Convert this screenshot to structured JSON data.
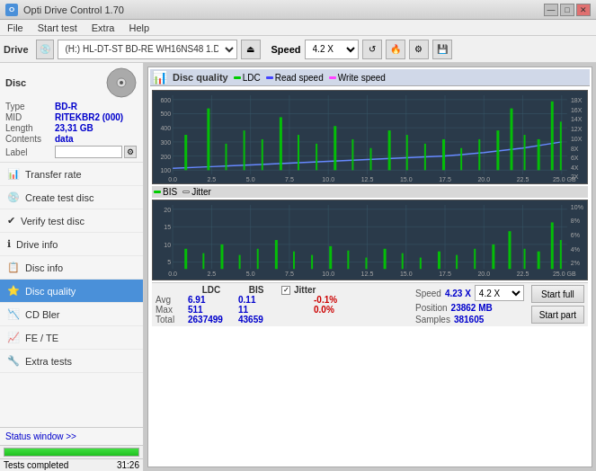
{
  "app": {
    "title": "Opti Drive Control 1.70",
    "icon_label": "ODC"
  },
  "title_controls": {
    "minimize": "—",
    "maximize": "□",
    "close": "✕"
  },
  "menu": {
    "items": [
      "File",
      "Start test",
      "Extra",
      "Help"
    ]
  },
  "toolbar": {
    "drive_label": "Drive",
    "drive_value": "(H:)  HL-DT-ST BD-RE  WH16NS48 1.D3",
    "speed_label": "Speed",
    "speed_value": "4.2 X"
  },
  "disc": {
    "section_title": "Disc",
    "type_label": "Type",
    "type_value": "BD-R",
    "mid_label": "MID",
    "mid_value": "RITEKBR2 (000)",
    "length_label": "Length",
    "length_value": "23,31 GB",
    "contents_label": "Contents",
    "contents_value": "data",
    "label_label": "Label",
    "label_placeholder": ""
  },
  "nav": {
    "items": [
      {
        "id": "transfer-rate",
        "label": "Transfer rate",
        "icon": "📊"
      },
      {
        "id": "create-test-disc",
        "label": "Create test disc",
        "icon": "💿"
      },
      {
        "id": "verify-test-disc",
        "label": "Verify test disc",
        "icon": "✔"
      },
      {
        "id": "drive-info",
        "label": "Drive info",
        "icon": "ℹ"
      },
      {
        "id": "disc-info",
        "label": "Disc info",
        "icon": "📋"
      },
      {
        "id": "disc-quality",
        "label": "Disc quality",
        "icon": "⭐",
        "active": true
      },
      {
        "id": "cd-bler",
        "label": "CD Bler",
        "icon": "📉"
      },
      {
        "id": "fe-te",
        "label": "FE / TE",
        "icon": "📈"
      },
      {
        "id": "extra-tests",
        "label": "Extra tests",
        "icon": "🔧"
      }
    ],
    "status_window": "Status window >>"
  },
  "chart_panel": {
    "title": "Disc quality",
    "legend": [
      {
        "id": "ldc",
        "label": "LDC",
        "color": "#00cc00"
      },
      {
        "id": "read-speed",
        "label": "Read speed",
        "color": "#4444ff"
      },
      {
        "id": "write-speed",
        "label": "Write speed",
        "color": "#ff44ff"
      }
    ],
    "legend2": [
      {
        "id": "bis",
        "label": "BIS",
        "color": "#00cc00"
      },
      {
        "id": "jitter",
        "label": "Jitter",
        "color": "#ffffff"
      }
    ],
    "upper_chart": {
      "y_left": [
        "600",
        "500",
        "400",
        "300",
        "200",
        "100"
      ],
      "y_right": [
        "18X",
        "16X",
        "14X",
        "12X",
        "10X",
        "8X",
        "6X",
        "4X",
        "2X"
      ],
      "x_labels": [
        "0.0",
        "2.5",
        "5.0",
        "7.5",
        "10.0",
        "12.5",
        "15.0",
        "17.5",
        "20.0",
        "22.5",
        "25.0 GB"
      ]
    },
    "lower_chart": {
      "y_left": [
        "20",
        "15",
        "10",
        "5"
      ],
      "y_right": [
        "10%",
        "8%",
        "6%",
        "4%",
        "2%"
      ],
      "x_labels": [
        "0.0",
        "2.5",
        "5.0",
        "7.5",
        "10.0",
        "12.5",
        "15.0",
        "17.5",
        "20.0",
        "22.5",
        "25.0 GB"
      ]
    }
  },
  "stats": {
    "col_ldc": "LDC",
    "col_bis": "BIS",
    "col_jitter": "Jitter",
    "col_speed": "Speed",
    "col_position": "Position",
    "col_samples": "Samples",
    "rows": [
      {
        "label": "Avg",
        "ldc": "6.91",
        "bis": "0.11",
        "jitter": "-0.1%"
      },
      {
        "label": "Max",
        "ldc": "511",
        "bis": "11",
        "jitter": "0.0%"
      },
      {
        "label": "Total",
        "ldc": "2637499",
        "bis": "43659",
        "jitter": ""
      }
    ],
    "jitter_checked": true,
    "speed_val": "4.23 X",
    "position_val": "23862 MB",
    "samples_val": "381605",
    "speed_select": "4.2 X",
    "start_full_label": "Start full",
    "start_part_label": "Start part"
  },
  "status_bar": {
    "text": "Tests completed",
    "progress": 100,
    "time": "31:26"
  }
}
